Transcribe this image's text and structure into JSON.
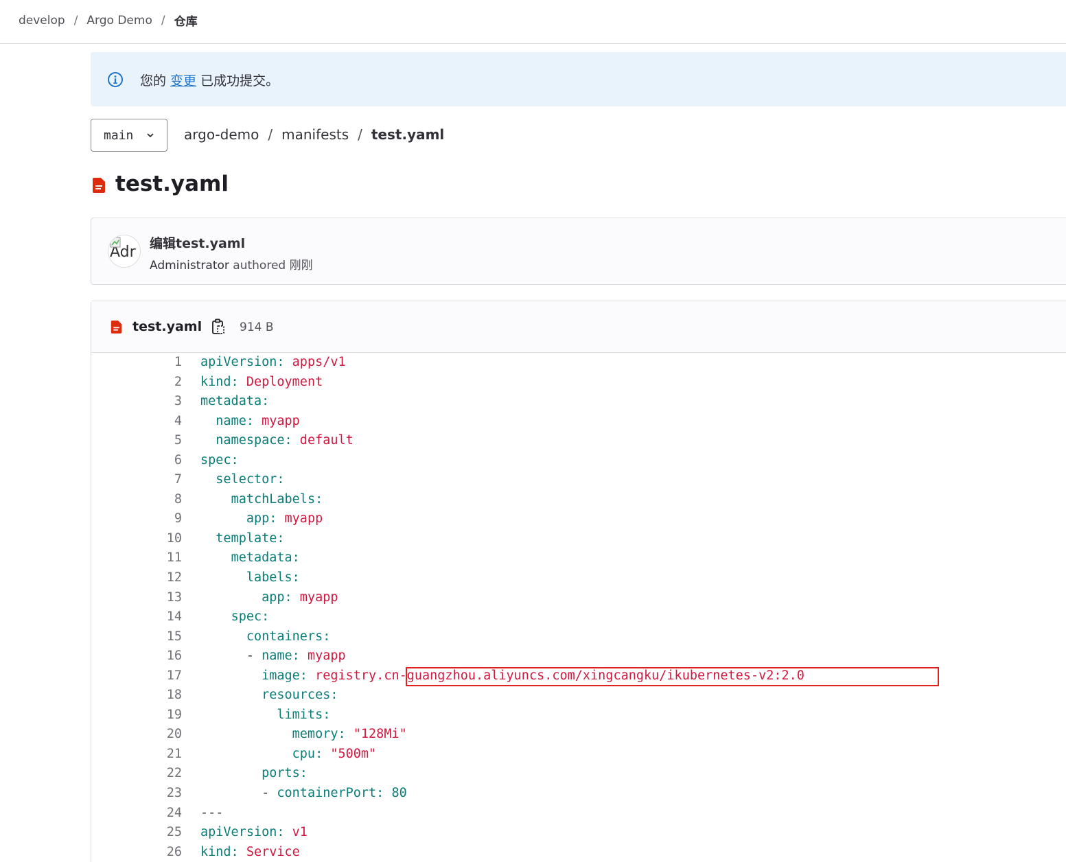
{
  "breadcrumb": {
    "items": [
      "develop",
      "Argo Demo"
    ],
    "current": "仓库"
  },
  "alert": {
    "before": "您的 ",
    "link": "变更",
    "after": " 已成功提交。"
  },
  "branch": {
    "name": "main"
  },
  "path": {
    "items": [
      "argo-demo",
      "manifests"
    ],
    "current": "test.yaml"
  },
  "page_title": "test.yaml",
  "commit": {
    "title": "编辑test.yaml",
    "avatar_alt": "Adr",
    "author": "Administrator",
    "authored": "authored",
    "time": "刚刚"
  },
  "file": {
    "name": "test.yaml",
    "size": "914 B"
  },
  "colors": {
    "key": "#0a7d77",
    "value": "#d0183f",
    "highlight_border": "#e0201b",
    "alert_bg": "#e9f3fc",
    "link": "#1f75cb"
  },
  "lines": [
    {
      "num": "1",
      "indent": "",
      "key": "apiVersion:",
      "val": " apps/v1",
      "type": "v"
    },
    {
      "num": "2",
      "indent": "",
      "key": "kind:",
      "val": " Deployment",
      "type": "v"
    },
    {
      "num": "3",
      "indent": "",
      "key": "metadata:",
      "val": "",
      "type": "v"
    },
    {
      "num": "4",
      "indent": "  ",
      "key": "name:",
      "val": " myapp",
      "type": "v"
    },
    {
      "num": "5",
      "indent": "  ",
      "key": "namespace:",
      "val": " default",
      "type": "v"
    },
    {
      "num": "6",
      "indent": "",
      "key": "spec:",
      "val": "",
      "type": "v"
    },
    {
      "num": "7",
      "indent": "  ",
      "key": "selector:",
      "val": "",
      "type": "v"
    },
    {
      "num": "8",
      "indent": "    ",
      "key": "matchLabels:",
      "val": "",
      "type": "v"
    },
    {
      "num": "9",
      "indent": "      ",
      "key": "app:",
      "val": " myapp",
      "type": "v"
    },
    {
      "num": "10",
      "indent": "  ",
      "key": "template:",
      "val": "",
      "type": "v"
    },
    {
      "num": "11",
      "indent": "    ",
      "key": "metadata:",
      "val": "",
      "type": "v"
    },
    {
      "num": "12",
      "indent": "      ",
      "key": "labels:",
      "val": "",
      "type": "v"
    },
    {
      "num": "13",
      "indent": "        ",
      "key": "app:",
      "val": " myapp",
      "type": "v"
    },
    {
      "num": "14",
      "indent": "    ",
      "key": "spec:",
      "val": "",
      "type": "v"
    },
    {
      "num": "15",
      "indent": "      ",
      "key": "containers:",
      "val": "",
      "type": "v"
    },
    {
      "num": "16",
      "indent": "      - ",
      "key": "name:",
      "val": " myapp",
      "type": "v"
    },
    {
      "num": "17",
      "indent": "        ",
      "key": "image:",
      "val": " registry.cn-guangzhou.aliyuncs.com/xingcangku/ikubernetes-v2:2.0",
      "type": "v",
      "highlight": true
    },
    {
      "num": "18",
      "indent": "        ",
      "key": "resources:",
      "val": "",
      "type": "v"
    },
    {
      "num": "19",
      "indent": "          ",
      "key": "limits:",
      "val": "",
      "type": "v"
    },
    {
      "num": "20",
      "indent": "            ",
      "key": "memory:",
      "val": " \"128Mi\"",
      "type": "v"
    },
    {
      "num": "21",
      "indent": "            ",
      "key": "cpu:",
      "val": " \"500m\"",
      "type": "v"
    },
    {
      "num": "22",
      "indent": "        ",
      "key": "ports:",
      "val": "",
      "type": "v"
    },
    {
      "num": "23",
      "indent": "        - ",
      "key": "containerPort:",
      "val": " 80",
      "type": "n"
    },
    {
      "num": "24",
      "indent": "",
      "key": "---",
      "val": "",
      "type": "v",
      "plain": true
    },
    {
      "num": "25",
      "indent": "",
      "key": "apiVersion:",
      "val": " v1",
      "type": "v"
    },
    {
      "num": "26",
      "indent": "",
      "key": "kind:",
      "val": " Service",
      "type": "v"
    }
  ]
}
